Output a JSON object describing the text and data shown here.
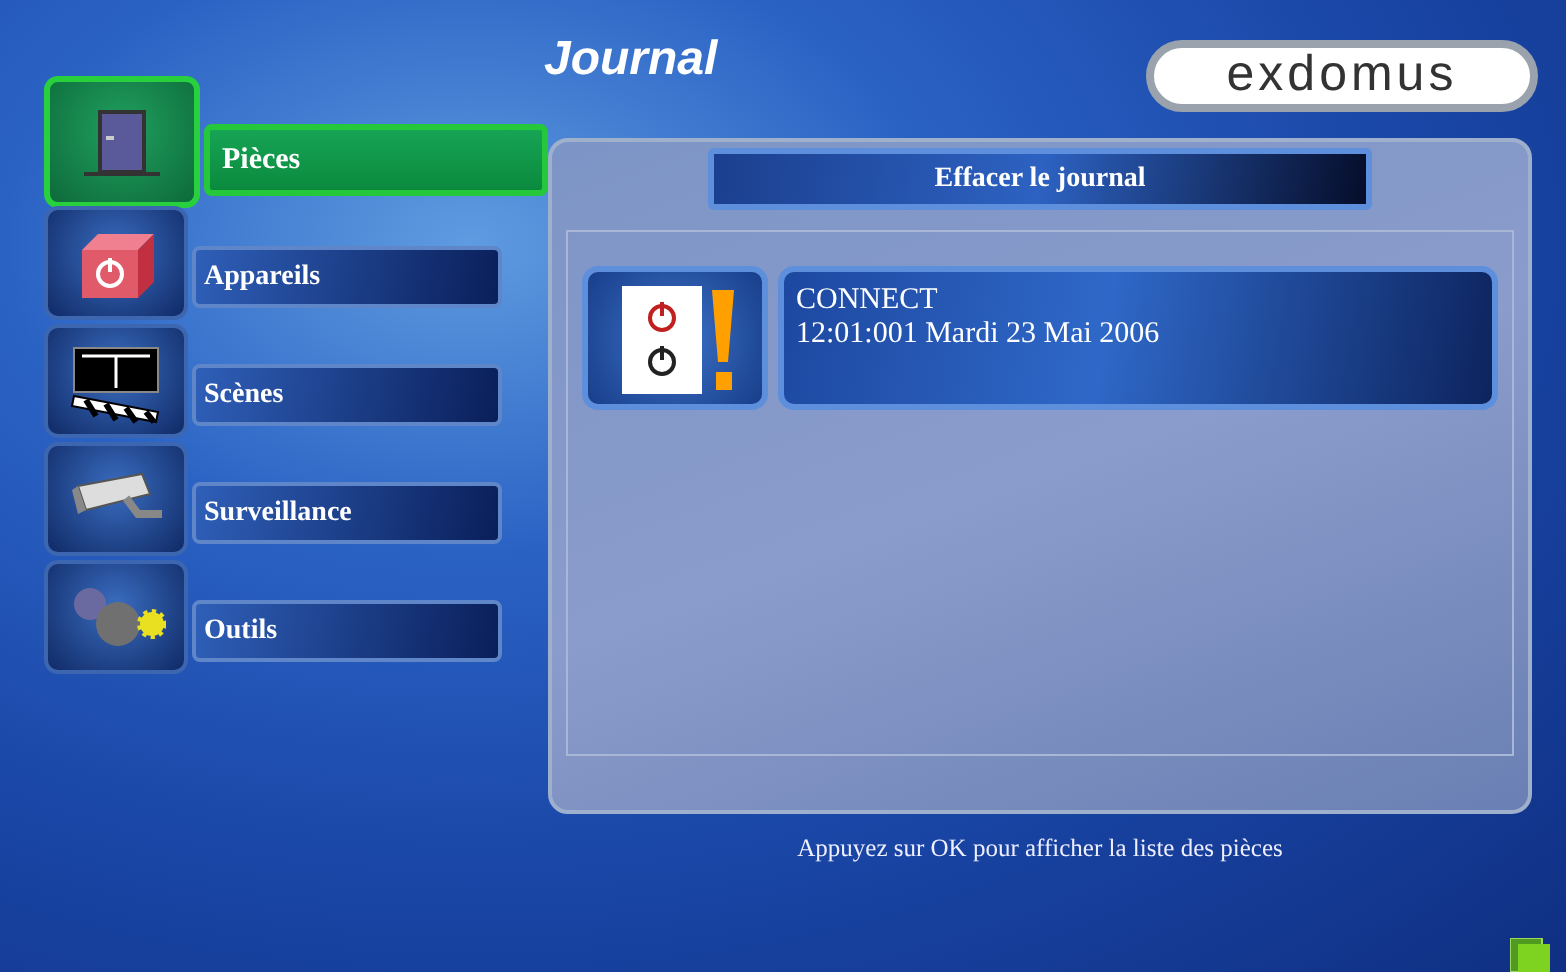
{
  "title": "Journal",
  "logo": "exdomus",
  "menu": [
    {
      "label": "Pièces",
      "kind": "door",
      "selected": true
    },
    {
      "label": "Appareils",
      "kind": "device",
      "selected": false
    },
    {
      "label": "Scènes",
      "kind": "scene",
      "selected": false
    },
    {
      "label": "Surveillance",
      "kind": "camera",
      "selected": false
    },
    {
      "label": "Outils",
      "kind": "tools",
      "selected": false
    }
  ],
  "clear_button": "Effacer le journal",
  "log_entries": [
    {
      "event": "CONNECT",
      "timestamp": "12:01:001 Mardi 23 Mai 2006"
    }
  ],
  "hint": "Appuyez sur OK pour afficher la liste des pièces"
}
